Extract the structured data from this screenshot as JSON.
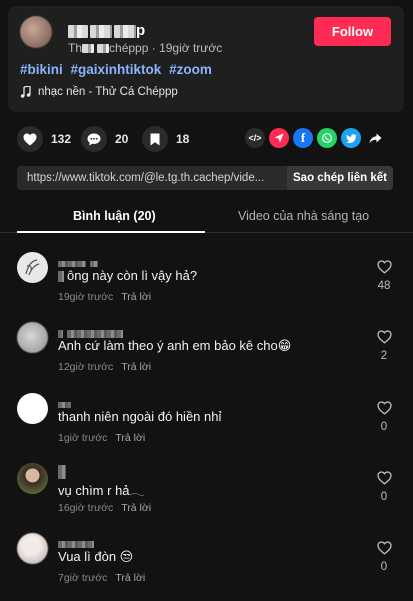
{
  "post": {
    "author_time": "19giờ trước",
    "author_handle_visible": "chéppp",
    "author_handle_prefix": "Th",
    "author_name_suffix": "p",
    "follow_label": "Follow",
    "hashtags": [
      "#bikini",
      "#gaixinhtiktok",
      "#zoom"
    ],
    "music": "nhạc nền - Thử Cá Chéppp"
  },
  "stats": {
    "likes": "132",
    "comments": "20",
    "saves": "18"
  },
  "share": {
    "link": "https://www.tiktok.com/@le.tg.th.cachep/vide...",
    "copy_label": "Sao chép liên kết"
  },
  "tabs": {
    "comments_label": "Bình luận (20)",
    "creator_videos_label": "Video của nhà sáng tạo"
  },
  "comments": [
    {
      "text": "ông này còn lì vậy hả?",
      "time": "19giờ trước",
      "reply": "Trả lời",
      "likes": "48"
    },
    {
      "text": "Anh cứ làm theo ý anh em bảo kê cho😁",
      "time": "12giờ trước",
      "reply": "Trả lời",
      "likes": "2"
    },
    {
      "text": "thanh niên ngoài đó hiền nhỉ",
      "time": "1giờ trước",
      "reply": "Trả lời",
      "likes": "0"
    },
    {
      "text": "vụ chìm r hả𓂃",
      "time": "16giờ trước",
      "reply": "Trả lời",
      "likes": "0"
    },
    {
      "text": "Vua lì đòn 😒",
      "time": "7giờ trước",
      "reply": "Trả lời",
      "likes": "0"
    }
  ],
  "colors": {
    "accent": "#fe2c55",
    "hashtag": "#8ab4ff",
    "background": "#121212"
  }
}
